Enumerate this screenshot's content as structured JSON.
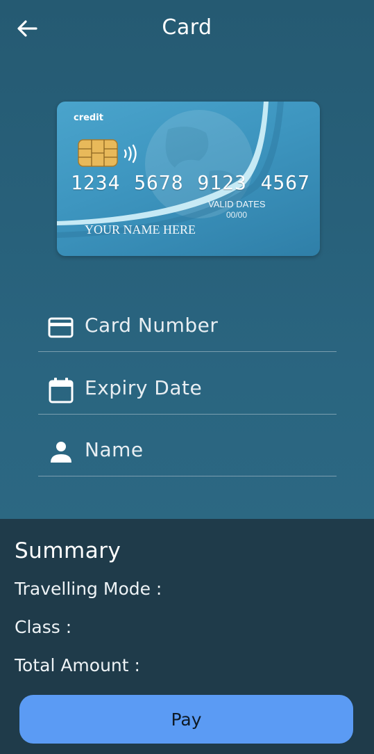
{
  "header": {
    "title": "Card",
    "back_icon": "arrow-left-icon"
  },
  "card": {
    "type": "credit",
    "number_groups": [
      "1234",
      "5678",
      "9123",
      "4567"
    ],
    "valid_label": "VALID DATES",
    "valid_value": "00/00",
    "name": "YOUR NAME HERE"
  },
  "form": {
    "fields": [
      {
        "label": "Card Number",
        "icon": "credit-card-icon"
      },
      {
        "label": "Expiry Date",
        "icon": "calendar-icon"
      },
      {
        "label": "Name",
        "icon": "person-icon"
      }
    ]
  },
  "summary": {
    "title": "Summary",
    "rows": [
      "Travelling Mode :",
      "Class :",
      "Total Amount :"
    ],
    "pay_label": "Pay"
  },
  "colors": {
    "background": "#2a6580",
    "summary_background": "#1f3b4a",
    "button": "#5b9bf4"
  }
}
